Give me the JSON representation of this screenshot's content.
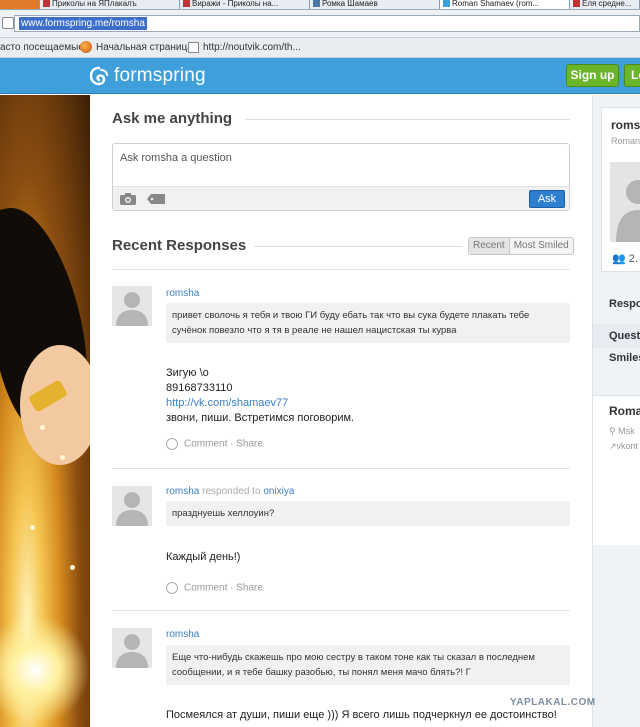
{
  "browser": {
    "tabs": [
      {
        "label": "Приколы на ЯПлакалъ",
        "active": false
      },
      {
        "label": "Виражи - Приколы на...",
        "active": false
      },
      {
        "label": "Ромка Шамаев",
        "active": false
      },
      {
        "label": "Roman Shamaev (rom...",
        "active": true
      },
      {
        "label": "Еля средне...",
        "active": false
      }
    ],
    "url": "www.formspring.me/romsha",
    "bookmarks": {
      "most_visited": "асто посещаемые",
      "home": "Начальная страница",
      "noutvik": "http://noutvik.com/th..."
    }
  },
  "header": {
    "logo": "formspring",
    "signup_label": "Sign up",
    "login_label": "Lo"
  },
  "ask": {
    "title": "Ask me anything",
    "placeholder": "Ask romsha a question",
    "ask_label": "Ask"
  },
  "recent": {
    "title": "Recent Responses",
    "filter_recent": "Recent",
    "filter_most_smiled": "Most Smiled"
  },
  "responses": [
    {
      "user": "romsha",
      "responded_to": "",
      "question": "привет сволочь я тебя и твою ГИ буду ебать так что вы сука будете плакать тебе сучёнок повезло что я тя в реале не нашел нацистская ты курва",
      "answer_lines": [
        "Зигую \\o",
        "89168733110"
      ],
      "answer_link": "http://vk.com/shamaev77",
      "answer_tail": "звони, пиши. Встретимся поговорим.",
      "comment_label": "Comment",
      "share_label": "Share"
    },
    {
      "user": "romsha",
      "responded_word": "responded to",
      "responded_to": "onixiya",
      "question": "празднуешь хеллоуин?",
      "answer": "Каждый день!)",
      "comment_label": "Comment",
      "share_label": "Share"
    },
    {
      "user": "romsha",
      "responded_to": "",
      "question": "Еще что-нибудь скажешь про мою сестру в таком тоне как ты сказал в последнем сообщении, и я тебе башку разобью, ты понял меня мачо блять?! Г",
      "answer": "Посмеялся ат души, пиши еще ))) Я всего лишь подчеркнул ее достоинство!"
    }
  ],
  "sidebar": {
    "name": "romsha",
    "subname": "Roman",
    "count": "2.",
    "tab_responses": "Respo",
    "tab_questions": "Quest",
    "tab_smiles": "Smiles",
    "about_name": "Roma",
    "location": "Msk",
    "vk": "vkont"
  },
  "watermark": "YAPLAKAL.COM"
}
